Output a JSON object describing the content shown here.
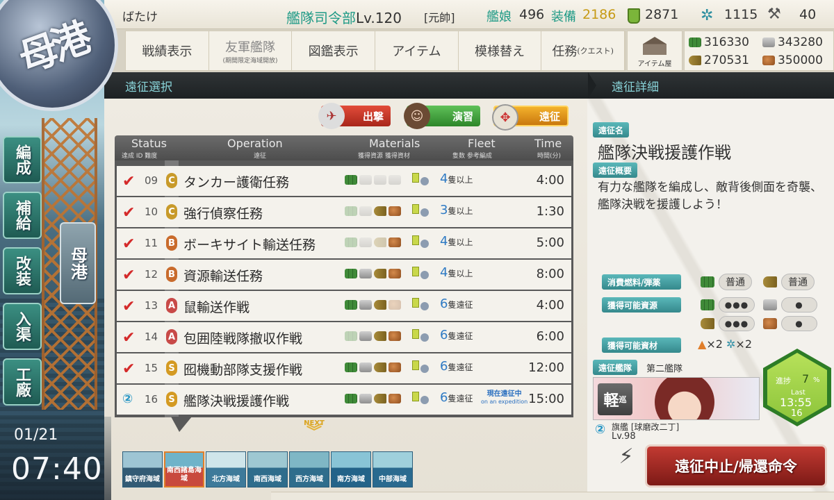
{
  "player": {
    "name": "ばたけ"
  },
  "header": {
    "hq_label": "艦隊司令部",
    "hq_level": "Lv.120",
    "rank": "[元帥]",
    "ships_label": "艦娘",
    "ships": "496",
    "equip_label": "装備",
    "equip": "2186",
    "buckets": "2871",
    "dev_screw": "1115",
    "dev_material": "40"
  },
  "nav": {
    "items": [
      {
        "label": "戦績表示",
        "sub": ""
      },
      {
        "label": "友軍艦隊",
        "sub": "(期間限定海域開放)"
      },
      {
        "label": "図鑑表示",
        "sub": ""
      },
      {
        "label": "アイテム",
        "sub": ""
      },
      {
        "label": "模様替え",
        "sub": ""
      },
      {
        "label": "任務",
        "sub": "(クエスト)"
      }
    ],
    "shop_label": "アイテム屋"
  },
  "resources": {
    "fuel": "316330",
    "steel": "343280",
    "ammo": "270531",
    "bauxite": "350000"
  },
  "sections": {
    "left_title": "遠征選択",
    "right_title": "遠征詳細"
  },
  "modes": {
    "sortie": "出撃",
    "practice": "演習",
    "expedition": "遠征"
  },
  "table": {
    "headers": {
      "status": "Status",
      "status_sub": "達成 ID 難度",
      "operation": "Operation",
      "operation_sub": "遠征",
      "materials": "Materials",
      "materials_sub": "獲得資源 獲得資材",
      "fleet": "Fleet",
      "fleet_sub": "隻数 参考編成",
      "time": "Time",
      "time_sub": "時間(分)"
    },
    "rows": [
      {
        "id": "09",
        "diff": "C",
        "name": "タンカー護衛任務",
        "ships": "4",
        "ships_unit": "隻以上",
        "time": "4:00"
      },
      {
        "id": "10",
        "diff": "C",
        "name": "強行偵察任務",
        "ships": "3",
        "ships_unit": "隻以上",
        "time": "1:30"
      },
      {
        "id": "11",
        "diff": "B",
        "name": "ボーキサイト輸送任務",
        "ships": "4",
        "ships_unit": "隻以上",
        "time": "5:00"
      },
      {
        "id": "12",
        "diff": "B",
        "name": "資源輸送任務",
        "ships": "4",
        "ships_unit": "隻以上",
        "time": "8:00"
      },
      {
        "id": "13",
        "diff": "A",
        "name": "鼠輸送作戦",
        "ships": "6",
        "ships_unit": "隻遠征",
        "time": "4:00"
      },
      {
        "id": "14",
        "diff": "A",
        "name": "包囲陸戦隊撤収作戦",
        "ships": "6",
        "ships_unit": "隻遠征",
        "time": "6:00"
      },
      {
        "id": "15",
        "diff": "S",
        "name": "囮機動部隊支援作戦",
        "ships": "6",
        "ships_unit": "隻遠征",
        "time": "12:00"
      },
      {
        "id": "16",
        "diff": "S",
        "name": "艦隊決戦援護作戦",
        "ships": "6",
        "ships_unit": "隻遠征",
        "time": "15:00",
        "ongoing": "現在遠征中",
        "ongoing_en": "on an expedition"
      }
    ],
    "next_label": "NEXT"
  },
  "sea_areas": [
    {
      "label": "鎮守府海域"
    },
    {
      "label": "南西諸島海域"
    },
    {
      "label": "北方海域"
    },
    {
      "label": "南西海域"
    },
    {
      "label": "西方海域"
    },
    {
      "label": "南方海域"
    },
    {
      "label": "中部海域"
    }
  ],
  "side_menu": {
    "emblem": "母港",
    "organize": "編成",
    "supply": "補給",
    "remodel": "改装",
    "dock": "入渠",
    "arsenal": "工廠",
    "port": "母港"
  },
  "clock": {
    "date": "01/21",
    "time": "07:40"
  },
  "detail": {
    "name_tag": "遠征名",
    "name": "艦隊決戦援護作戦",
    "summary_tag": "遠征概要",
    "summary": "有力な艦隊を編成し、敵背後側面を奇襲、艦隊決戦を援護しよう！",
    "consume_tag": "消費燃料/弾薬",
    "consume_fuel": "普通",
    "consume_ammo": "普通",
    "gain_res_tag": "獲得可能資源",
    "gain_fuel": "●●●",
    "gain_steel": "●",
    "gain_ammo": "●●●",
    "gain_baux": "●",
    "gain_items_tag": "獲得可能資材",
    "gain_item1": "×2",
    "gain_item2": "×2",
    "fleet_tag": "遠征艦隊",
    "fleet_name": "第二艦隊",
    "ship_class": "軽",
    "ship_class_sub": "巡",
    "flagship_label": "旗艦 [球磨改二丁]",
    "flagship_level": "Lv.98",
    "progress_label": "進捗",
    "progress_pct": "7",
    "progress_unit": "%",
    "last_label": "Last",
    "remaining": "13:55",
    "count": "16",
    "recall_button": "遠征中止/帰還命令"
  }
}
